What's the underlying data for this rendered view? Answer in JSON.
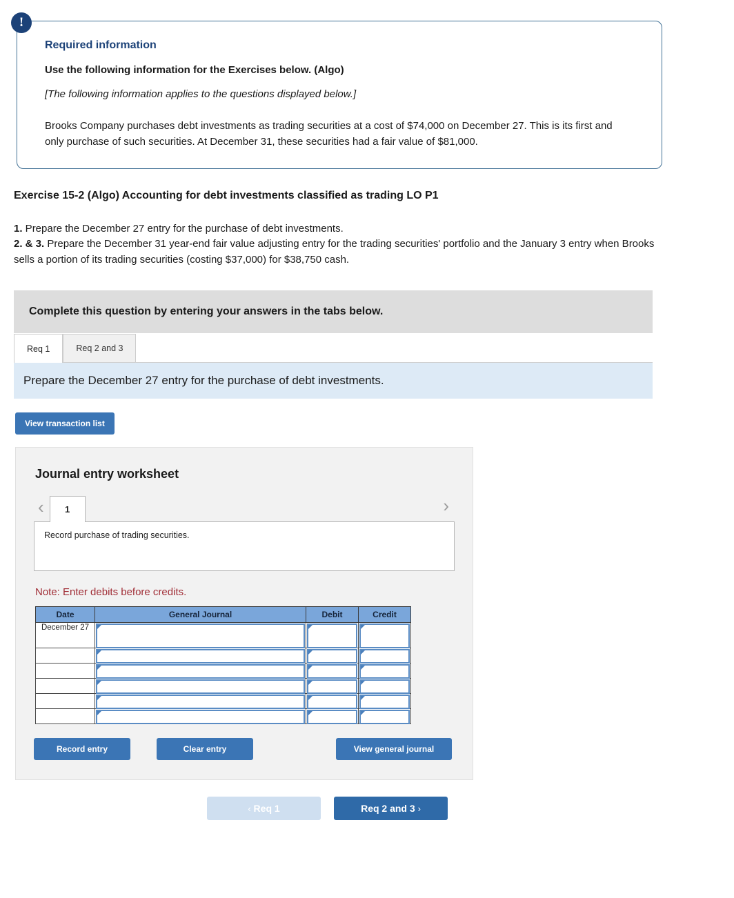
{
  "alert": {
    "icon": "exclamation-icon",
    "glyph": "!"
  },
  "required_info": {
    "title": "Required information",
    "subtitle": "Use the following information for the Exercises below. (Algo)",
    "italic_note": "[The following information applies to the questions displayed below.]",
    "body": "Brooks Company purchases debt investments as trading securities at a cost of $74,000 on December 27. This is its first and only purchase of such securities. At December 31, these securities had a fair value of $81,000."
  },
  "exercise": {
    "title": "Exercise 15-2 (Algo) Accounting for debt investments classified as trading LO P1",
    "requirement_1_lead": "1.",
    "requirement_1_text": " Prepare the December 27 entry for the purchase of debt investments.",
    "requirement_23_lead": "2. & 3.",
    "requirement_23_text": " Prepare the December 31 year-end fair value adjusting entry for the trading securities' portfolio and the January 3 entry when Brooks sells a portion of its trading securities (costing $37,000) for $38,750 cash."
  },
  "complete_banner": "Complete this question by entering your answers in the tabs below.",
  "tabs": [
    {
      "label": "Req 1",
      "active": true
    },
    {
      "label": "Req 2 and 3",
      "active": false
    }
  ],
  "instruction_banner": "Prepare the December 27 entry for the purchase of debt investments.",
  "view_transaction_list_label": "View transaction list",
  "worksheet": {
    "title": "Journal entry worksheet",
    "prev_icon": "chevron-left-icon",
    "next_icon": "chevron-right-icon",
    "prev_glyph": "‹",
    "next_glyph": "›",
    "page_number": "1",
    "description": "Record purchase of trading securities.",
    "note": "Note: Enter debits before credits.",
    "table": {
      "columns": [
        "Date",
        "General Journal",
        "Debit",
        "Credit"
      ],
      "rows": [
        {
          "date": "December 27",
          "journal": "",
          "debit": "",
          "credit": ""
        },
        {
          "date": "",
          "journal": "",
          "debit": "",
          "credit": ""
        },
        {
          "date": "",
          "journal": "",
          "debit": "",
          "credit": ""
        },
        {
          "date": "",
          "journal": "",
          "debit": "",
          "credit": ""
        },
        {
          "date": "",
          "journal": "",
          "debit": "",
          "credit": ""
        },
        {
          "date": "",
          "journal": "",
          "debit": "",
          "credit": ""
        }
      ]
    },
    "buttons": {
      "record": "Record entry",
      "clear": "Clear entry",
      "view_general_journal": "View general journal"
    }
  },
  "bottom_nav": {
    "prev_label": "Req 1",
    "prev_chevron": "‹",
    "next_label": "Req 2 and 3",
    "next_chevron": "›"
  },
  "colors": {
    "accent_blue": "#3b75b5",
    "dark_navy": "#1c4278",
    "table_header_blue": "#7aa6da",
    "banner_blue": "#ddeaf6",
    "banner_gray": "#dddddd",
    "note_red": "#a02c35",
    "panel_gray": "#f2f2f2"
  }
}
